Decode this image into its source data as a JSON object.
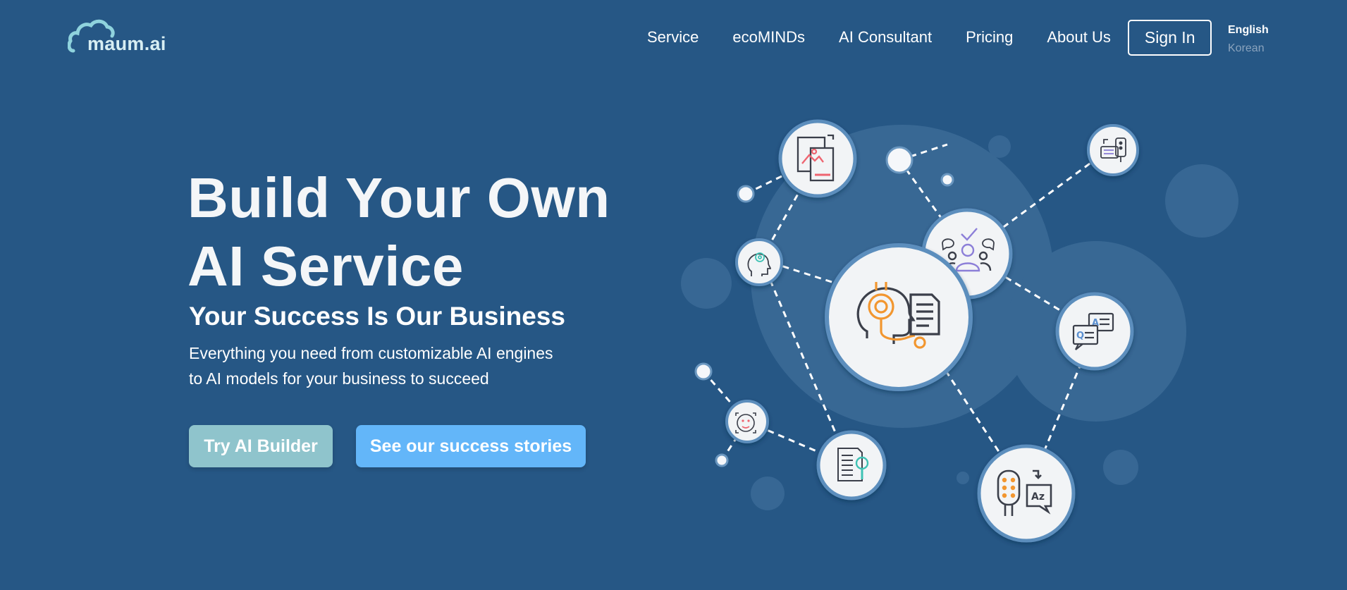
{
  "brand": {
    "logo_text": "maum.ai"
  },
  "nav": {
    "items": [
      "Service",
      "ecoMINDs",
      "AI Consultant",
      "Pricing",
      "About Us"
    ],
    "signin_label": "Sign In"
  },
  "language": {
    "english": "English",
    "korean": "Korean"
  },
  "hero": {
    "title_line1": "Build Your Own",
    "title_line2": "AI Service",
    "subtitle_part1": "Your ",
    "subtitle_bold1": "Success",
    "subtitle_part2": " Is Our ",
    "subtitle_bold2": "Business",
    "desc_line1": "Everything you need from customizable AI engines",
    "desc_line2": "to AI models for your business to succeed"
  },
  "buttons": {
    "try_label": "Try AI Builder",
    "success_label": "See our success stories"
  },
  "colors": {
    "background": "#265785",
    "try_button": "#8fc4cc",
    "success_button": "#63b6f9",
    "icon_orange": "#f2962f",
    "icon_purple": "#8c7fd8",
    "icon_teal": "#3ec2b4"
  },
  "illustration_icons": [
    "document-image-icon",
    "chat-robot-icon",
    "brain-head-icon",
    "team-check-icon",
    "headset-ai-head-icon",
    "qa-chat-icon",
    "face-recognition-icon",
    "document-search-icon",
    "voice-translate-icon"
  ]
}
